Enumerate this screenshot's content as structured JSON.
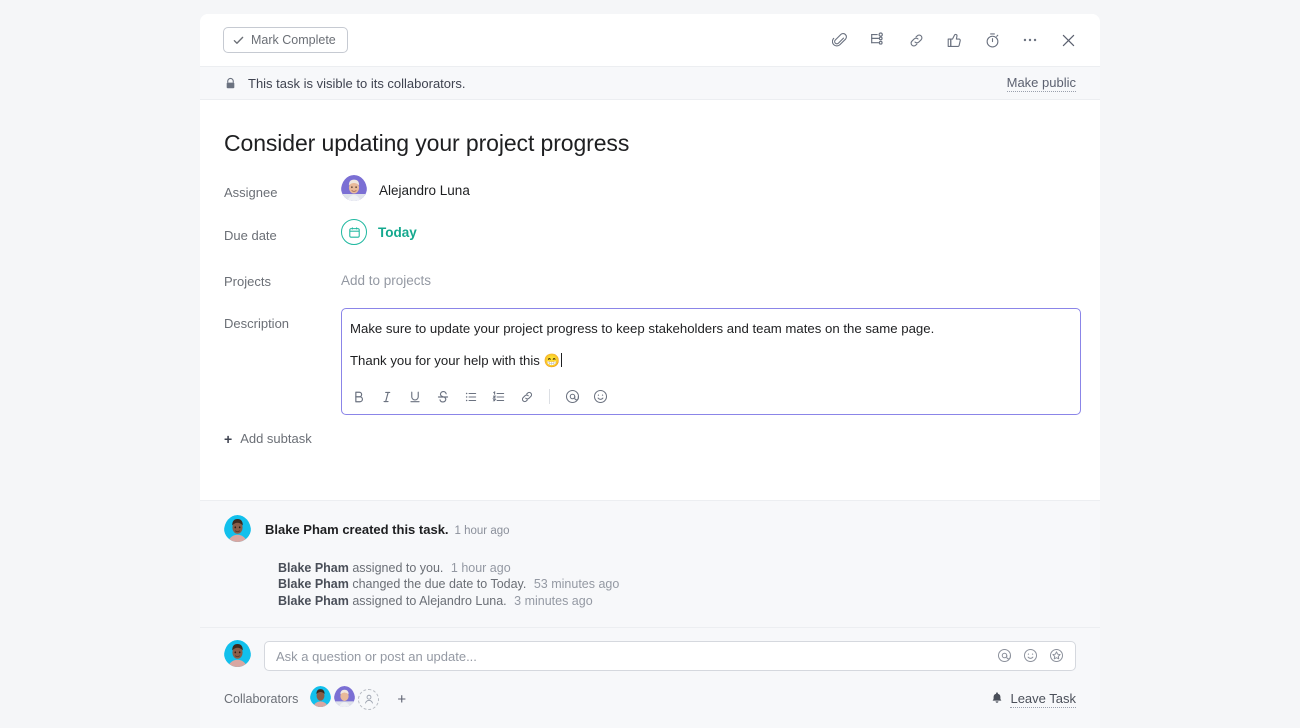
{
  "header": {
    "mark_complete_label": "Mark Complete",
    "icons": [
      {
        "name": "attachment-icon",
        "title": "Attach file"
      },
      {
        "name": "subtask-icon",
        "title": "Add subtask"
      },
      {
        "name": "link-icon",
        "title": "Copy task link"
      },
      {
        "name": "like-icon",
        "title": "Like"
      },
      {
        "name": "timer-icon",
        "title": "Timer"
      },
      {
        "name": "more-options-icon",
        "title": "More"
      },
      {
        "name": "close-icon",
        "title": "Close"
      }
    ]
  },
  "privacy": {
    "message": "This task is visible to its collaborators.",
    "action_label": "Make public",
    "icon": "lock-icon"
  },
  "task": {
    "title": "Consider updating your project progress",
    "fields": {
      "assignee_label": "Assignee",
      "assignee_name": "Alejandro Luna",
      "due_date_label": "Due date",
      "due_date_value": "Today",
      "projects_label": "Projects",
      "projects_placeholder": "Add to projects",
      "description_label": "Description"
    },
    "description": {
      "paragraph_1": "Make sure to update your project progress to keep stakeholders and team mates on the same page.",
      "paragraph_2": "Thank you for your help with this ",
      "emoji": "😁"
    },
    "format_toolbar": [
      {
        "name": "bold-icon",
        "glyph": "B"
      },
      {
        "name": "italic-icon",
        "glyph": "I"
      },
      {
        "name": "underline-icon",
        "glyph": "U"
      },
      {
        "name": "strikethrough-icon",
        "glyph": "S"
      },
      {
        "name": "bulleted-list-icon",
        "glyph": "•"
      },
      {
        "name": "numbered-list-icon",
        "glyph": "1."
      },
      {
        "name": "link-icon",
        "glyph": "🔗"
      },
      {
        "name": "mention-icon",
        "glyph": "@"
      },
      {
        "name": "emoji-icon",
        "glyph": "☺"
      }
    ],
    "add_subtask_label": "Add subtask"
  },
  "activity": {
    "created_by": "Blake Pham created this task.",
    "created_time": "1 hour ago",
    "entries": [
      {
        "actor": "Blake Pham",
        "action": "assigned to you.",
        "time": "1 hour ago"
      },
      {
        "actor": "Blake Pham",
        "action": "changed the due date to Today.",
        "time": "53 minutes ago"
      },
      {
        "actor": "Blake Pham",
        "action": "assigned to Alejandro Luna.",
        "time": "3 minutes ago"
      }
    ]
  },
  "comment": {
    "placeholder": "Ask a question or post an update...",
    "icons": [
      {
        "name": "mention-icon"
      },
      {
        "name": "emoji-icon"
      },
      {
        "name": "sticker-icon"
      }
    ]
  },
  "footer": {
    "collaborators_label": "Collaborators",
    "add_collaborator_plus": "+",
    "leave_task_label": "Leave Task"
  },
  "colors": {
    "accent_due": "#14a88e",
    "focus_border": "#8b85e8",
    "avatar_blake": "#12c0ec",
    "avatar_alejandro": "#7b6fd4",
    "page_bg": "#f5f6f8",
    "panel_bg": "#ffffff"
  }
}
